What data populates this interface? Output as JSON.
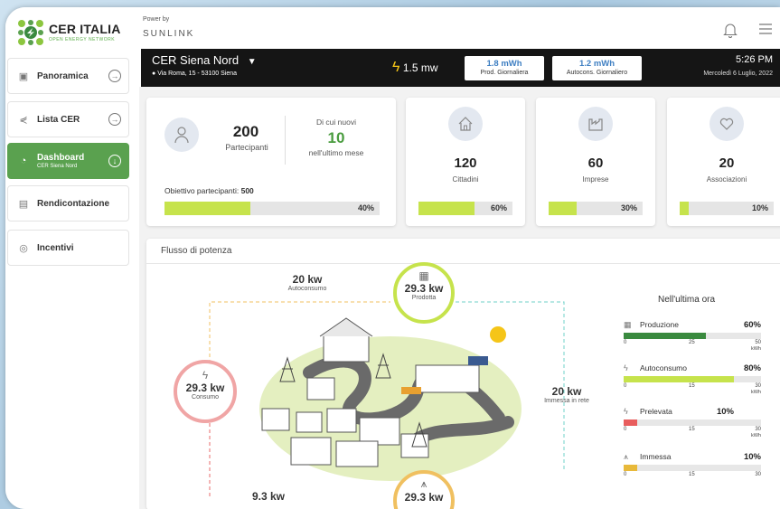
{
  "brand": {
    "title": "CER ITALIA",
    "subtitle": "OPEN ENERGY NETWORK",
    "powered_by": "Power by",
    "partner": "SUNLINK"
  },
  "nav": [
    {
      "label": "Panoramica",
      "icon": "folder-icon",
      "active": false
    },
    {
      "label": "Lista CER",
      "icon": "share-icon",
      "active": false
    },
    {
      "label": "Dashboard",
      "sub": "CER Siena Nord",
      "icon": "gauge-icon",
      "active": true
    },
    {
      "label": "Rendicontazione",
      "icon": "document-icon",
      "active": false
    },
    {
      "label": "Incentivi",
      "icon": "coin-icon",
      "active": false
    }
  ],
  "topbar": {
    "cer_name": "CER Siena Nord",
    "address": "Via Roma, 15 - 53100 Siena",
    "power": "1.5 mw",
    "prod_value": "1.8 mWh",
    "prod_label": "Prod. Giornaliera",
    "autocons_value": "1.2 mWh",
    "autocons_label": "Autocons. Giornaliero",
    "time": "5:26 PM",
    "date": "Mercoledì 6 Luglio, 2022"
  },
  "participants": {
    "count": "200",
    "label": "Partecipanti",
    "new_label": "Di cui nuovi",
    "new_count": "10",
    "new_sub": "nell'ultimo mese",
    "goal_label": "Obiettivo partecipanti:",
    "goal_value": "500",
    "progress": 40,
    "progress_label": "40%"
  },
  "categories": [
    {
      "count": "120",
      "label": "Cittadini",
      "progress": 60,
      "progress_label": "60%",
      "icon": "house-icon"
    },
    {
      "count": "60",
      "label": "Imprese",
      "progress": 30,
      "progress_label": "30%",
      "icon": "factory-icon"
    },
    {
      "count": "20",
      "label": "Associazioni",
      "progress": 10,
      "progress_label": "10%",
      "icon": "heart-hands-icon"
    }
  ],
  "flow": {
    "title": "Flusso di potenza",
    "autoconsumo_value": "20 kw",
    "autoconsumo_label": "Autoconsumo",
    "prodotta_value": "29.3 kw",
    "prodotta_label": "Prodotta",
    "consumo_value": "29.3 kw",
    "consumo_label": "Consumo",
    "immessa_value": "20 kw",
    "immessa_label": "Immessa in rete",
    "bottom_left_value": "9.3 kw",
    "bottom_center_value": "29.3 kw"
  },
  "last_hour": {
    "title": "Nell'ultima ora",
    "rows": [
      {
        "label": "Produzione",
        "pct": "60%",
        "progress": 60,
        "color": "#3a8a3f",
        "ticks": [
          "0",
          "25",
          "50"
        ],
        "unit": "kWh",
        "icon": "solar-panel-icon"
      },
      {
        "label": "Autoconsumo",
        "pct": "80%",
        "progress": 80,
        "color": "#c6e34c",
        "ticks": [
          "0",
          "15",
          "30"
        ],
        "unit": "kWh",
        "icon": "bolt-icon"
      },
      {
        "label": "Prelevata",
        "pct": "10%",
        "progress": 10,
        "color": "#e85d5d",
        "ticks": [
          "0",
          "15",
          "30"
        ],
        "unit": "kWh",
        "icon": "bolt-icon"
      },
      {
        "label": "Immessa",
        "pct": "10%",
        "progress": 10,
        "color": "#e8b93a",
        "ticks": [
          "0",
          "15",
          "30"
        ],
        "unit": "",
        "icon": "pylon-icon"
      }
    ]
  }
}
